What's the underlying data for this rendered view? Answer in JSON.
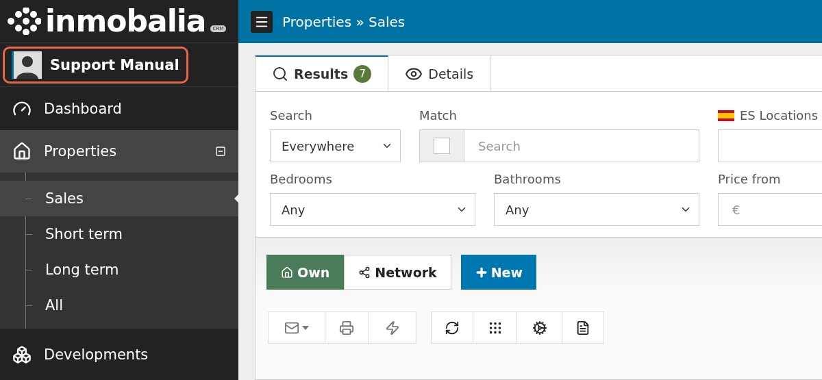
{
  "logo": {
    "name": "inmobalia",
    "badge": "CRM"
  },
  "user": {
    "name": "Support Manual",
    "highlighted": true
  },
  "sidebar": {
    "items": [
      {
        "label": "Dashboard",
        "kind": "dashboard",
        "selected": false
      },
      {
        "label": "Properties",
        "kind": "properties",
        "selected": true,
        "expanded": true,
        "children": [
          {
            "label": "Sales",
            "selected": true
          },
          {
            "label": "Short term",
            "selected": false
          },
          {
            "label": "Long term",
            "selected": false
          },
          {
            "label": "All",
            "selected": false
          }
        ]
      },
      {
        "label": "Developments",
        "kind": "developments",
        "selected": false
      }
    ]
  },
  "breadcrumb": {
    "parent": "Properties",
    "separator": "»",
    "current": "Sales"
  },
  "tabs": [
    {
      "label": "Results",
      "kind": "results",
      "badge": "7",
      "selected": true
    },
    {
      "label": "Details",
      "kind": "details",
      "selected": false
    }
  ],
  "filters": [
    {
      "label": "Search",
      "kind": "select",
      "value": "Everywhere"
    },
    {
      "label": "Match",
      "kind": "checkbox-input",
      "checked": false,
      "placeholder": "Search"
    },
    {
      "label": "ES Locations",
      "kind": "input",
      "flag": true
    },
    {
      "label": "Bedrooms",
      "kind": "select",
      "value": "Any"
    },
    {
      "label": "Bathrooms",
      "kind": "select",
      "value": "Any"
    },
    {
      "label": "Price from",
      "kind": "input",
      "placeholder": "€"
    }
  ],
  "scope_buttons": [
    {
      "label": "Own",
      "kind": "own",
      "selected": true
    },
    {
      "label": "Network",
      "kind": "network",
      "selected": false
    }
  ],
  "new_button": {
    "label": "New"
  },
  "toolbar_groups": [
    {
      "buttons": [
        {
          "kind": "mail"
        },
        {
          "kind": "print"
        },
        {
          "kind": "flash"
        }
      ]
    },
    {
      "buttons": [
        {
          "kind": "refresh"
        },
        {
          "kind": "grid"
        },
        {
          "kind": "settings"
        },
        {
          "kind": "document"
        }
      ]
    }
  ]
}
